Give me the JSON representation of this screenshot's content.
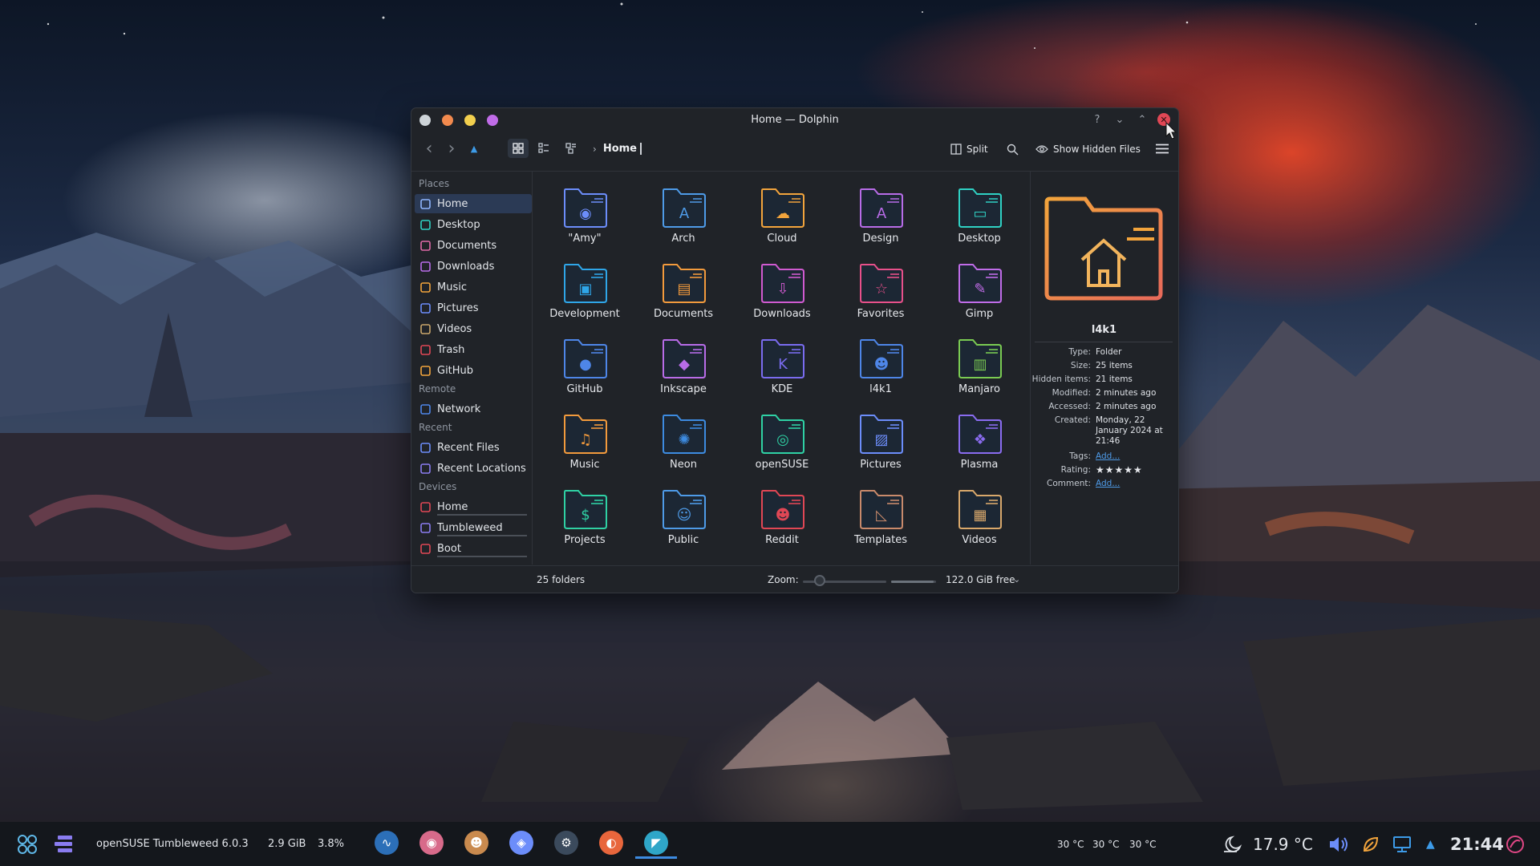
{
  "window": {
    "title": "Home — Dolphin",
    "dot_colors": [
      "#cdd3d8",
      "#f28a4e",
      "#f2cf4e",
      "#c06ce8"
    ],
    "help_glyph": "?",
    "minimize_glyph": "⌄",
    "maximize_glyph": "⌃",
    "close_glyph": "✕"
  },
  "toolbar": {
    "back_glyph": "‹",
    "forward_glyph": "›",
    "up_glyph": "▲",
    "breadcrumb_sep": "›",
    "breadcrumb_current": "Home",
    "split_label": "Split",
    "show_hidden_label": "Show Hidden Files"
  },
  "sidebar": {
    "places_title": "Places",
    "places": [
      {
        "label": "Home",
        "icon": "home-icon",
        "color": "#8fb6ff",
        "selected": true
      },
      {
        "label": "Desktop",
        "icon": "desktop-icon",
        "color": "#2fd1c4"
      },
      {
        "label": "Documents",
        "icon": "documents-icon",
        "color": "#e06aa8"
      },
      {
        "label": "Downloads",
        "icon": "downloads-icon",
        "color": "#b86ce8"
      },
      {
        "label": "Music",
        "icon": "music-icon",
        "color": "#f2a43c"
      },
      {
        "label": "Pictures",
        "icon": "pictures-icon",
        "color": "#6c8dfa"
      },
      {
        "label": "Videos",
        "icon": "videos-icon",
        "color": "#c9a66b"
      },
      {
        "label": "Trash",
        "icon": "trash-icon",
        "color": "#e04755"
      },
      {
        "label": "GitHub",
        "icon": "github-icon",
        "color": "#f2a43c"
      }
    ],
    "remote_title": "Remote",
    "remote": [
      {
        "label": "Network",
        "icon": "network-icon",
        "color": "#4e86e8"
      }
    ],
    "recent_title": "Recent",
    "recent": [
      {
        "label": "Recent Files",
        "icon": "recent-files-icon",
        "color": "#6c8dfa"
      },
      {
        "label": "Recent Locations",
        "icon": "recent-locations-icon",
        "color": "#8a7cf0"
      }
    ],
    "devices_title": "Devices",
    "devices": [
      {
        "label": "Home",
        "icon": "drive-icon",
        "color": "#e04755"
      },
      {
        "label": "Tumbleweed",
        "icon": "drive-icon",
        "color": "#8a7cf0"
      },
      {
        "label": "Boot",
        "icon": "drive-icon",
        "color": "#e04755"
      }
    ]
  },
  "files": [
    {
      "name": "\"Amy\"",
      "stroke": "#6c8dfa",
      "glyph": "◉"
    },
    {
      "name": "Arch",
      "stroke": "#4e9be8",
      "glyph": "A"
    },
    {
      "name": "Cloud",
      "stroke": "#f2a43c",
      "glyph": "☁"
    },
    {
      "name": "Design",
      "stroke": "#b86ce8",
      "glyph": "A"
    },
    {
      "name": "Desktop",
      "stroke": "#2fd1c4",
      "glyph": "▭"
    },
    {
      "name": "Development",
      "stroke": "#2fa6e8",
      "glyph": "▣"
    },
    {
      "name": "Documents",
      "stroke": "#f29a3c",
      "glyph": "▤"
    },
    {
      "name": "Downloads",
      "stroke": "#d05ad0",
      "glyph": "⇩"
    },
    {
      "name": "Favorites",
      "stroke": "#e8508a",
      "glyph": "☆"
    },
    {
      "name": "Gimp",
      "stroke": "#c06ce8",
      "glyph": "✎"
    },
    {
      "name": "GitHub",
      "stroke": "#4e86e8",
      "glyph": "●"
    },
    {
      "name": "Inkscape",
      "stroke": "#b86ce8",
      "glyph": "◆"
    },
    {
      "name": "KDE",
      "stroke": "#7a6cf0",
      "glyph": "K"
    },
    {
      "name": "l4k1",
      "stroke": "#4e86e8",
      "glyph": "☻"
    },
    {
      "name": "Manjaro",
      "stroke": "#7acb52",
      "glyph": "▥"
    },
    {
      "name": "Music",
      "stroke": "#f29a3c",
      "glyph": "♫"
    },
    {
      "name": "Neon",
      "stroke": "#3d8be0",
      "glyph": "✺"
    },
    {
      "name": "openSUSE",
      "stroke": "#2fd1a4",
      "glyph": "◎"
    },
    {
      "name": "Pictures",
      "stroke": "#6c8dfa",
      "glyph": "▨"
    },
    {
      "name": "Plasma",
      "stroke": "#8a6cf0",
      "glyph": "❖"
    },
    {
      "name": "Projects",
      "stroke": "#2fd1a4",
      "glyph": "$"
    },
    {
      "name": "Public",
      "stroke": "#4e9be8",
      "glyph": "☺"
    },
    {
      "name": "Reddit",
      "stroke": "#e04755",
      "glyph": "☻"
    },
    {
      "name": "Templates",
      "stroke": "#c98a6b",
      "glyph": "◺"
    },
    {
      "name": "Videos",
      "stroke": "#d9a86b",
      "glyph": "▦"
    }
  ],
  "info": {
    "name": "l4k1",
    "icon": "home-folder-icon",
    "icon_color": "#f2a43c",
    "rows": [
      {
        "label": "Type:",
        "value": "Folder"
      },
      {
        "label": "Size:",
        "value": "25 items"
      },
      {
        "label": "Hidden items:",
        "value": "21 items"
      },
      {
        "label": "Modified:",
        "value": "2 minutes ago"
      },
      {
        "label": "Accessed:",
        "value": "2 minutes ago"
      },
      {
        "label": "Created:",
        "value": "Monday, 22 January 2024 at 21:46"
      },
      {
        "label": "Tags:",
        "value": "Add...",
        "link": true
      },
      {
        "label": "Rating:",
        "value": "★★★★★",
        "stars": true
      },
      {
        "label": "Comment:",
        "value": "Add...",
        "link": true
      }
    ]
  },
  "status": {
    "count": "25 folders",
    "zoom_label": "Zoom:",
    "zoom_value": 0.2,
    "free": "122.0 GiB free",
    "free_used_fraction": 0.95
  },
  "taskbar": {
    "os_label": "openSUSE Tumbleweed 6.0.3",
    "mem": "2.9 GiB",
    "cpu": "3.8%",
    "temps": [
      "30 °C",
      "30 °C",
      "30 °C"
    ],
    "weather_temp": "17.9 °C",
    "clock": "21:44",
    "apps": [
      {
        "icon": "system-monitor-icon",
        "color": "#2c6fb8",
        "glyph": "∿"
      },
      {
        "icon": "app-launcher-icon",
        "color": "#d86a8a",
        "glyph": "◉"
      },
      {
        "icon": "emoji-app-icon",
        "color": "#c98a4e",
        "glyph": "☻"
      },
      {
        "icon": "discover-icon",
        "color": "#6c8dfa",
        "glyph": "◈"
      },
      {
        "icon": "steam-icon",
        "color": "#3b4a5c",
        "glyph": "⚙"
      },
      {
        "icon": "firefox-icon",
        "color": "#e8663c",
        "glyph": "◐"
      },
      {
        "icon": "dolphin-icon",
        "color": "#2fa6c8",
        "glyph": "◤",
        "active": true
      }
    ]
  }
}
